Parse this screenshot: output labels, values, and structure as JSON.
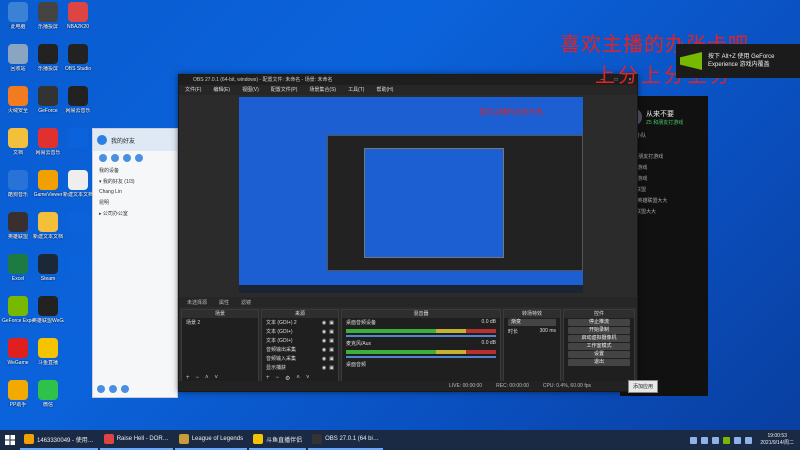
{
  "desktop": {
    "icons": [
      {
        "label": "此电脑",
        "color": "#3b82d6"
      },
      {
        "label": "乐播投屏",
        "color": "#444"
      },
      {
        "label": "NBA2K20",
        "color": "#d44"
      },
      {
        "label": "回收站",
        "color": "#8aa5c2"
      },
      {
        "label": "乐播投屏",
        "color": "#222"
      },
      {
        "label": "OBS Studio",
        "color": "#222"
      },
      {
        "label": "火绒安全",
        "color": "#f27b1f"
      },
      {
        "label": "GeForce",
        "color": "#333"
      },
      {
        "label": "网易云音乐",
        "color": "#222"
      },
      {
        "label": "文档",
        "color": "#f3c03c"
      },
      {
        "label": "网易云音乐",
        "color": "#e03030"
      },
      {
        "label": "",
        "color": "#0b63db"
      },
      {
        "label": "酷狗音乐",
        "color": "#2773d8"
      },
      {
        "label": "GameViewer",
        "color": "#f0a000"
      },
      {
        "label": "新建文本文档",
        "color": "#eee"
      },
      {
        "label": "英雄联盟",
        "color": "#3a2f2f"
      },
      {
        "label": "新建文本文档",
        "color": "#f3c03c"
      },
      {
        "label": "",
        "color": "#0b63db"
      },
      {
        "label": "Excel",
        "color": "#1d7a43"
      },
      {
        "label": "Steam",
        "color": "#1b2838"
      },
      {
        "label": "",
        "color": "#0b63db"
      },
      {
        "label": "GeForce Experience",
        "color": "#76b900"
      },
      {
        "label": "英雄联盟WeGame",
        "color": "#222"
      },
      {
        "label": "",
        "color": "#0b63db"
      },
      {
        "label": "WeGame",
        "color": "#e02020"
      },
      {
        "label": "斗鱼直播",
        "color": "#f5c400"
      },
      {
        "label": "",
        "color": "#0b63db"
      },
      {
        "label": "PP助手",
        "color": "#f2a900"
      },
      {
        "label": "微信",
        "color": "#2ec24a"
      },
      {
        "label": "",
        "color": "#0b63db"
      }
    ]
  },
  "overlay": {
    "line1": "喜欢主播的办张卡吧。",
    "line2": "上分上分上分"
  },
  "geforce_notice": {
    "text1": "按下 Alt+Z 使用 GeForce",
    "text2": "Experience 游戏内覆盖"
  },
  "chat_panel": {
    "name": "从来不要",
    "status": "Z5 和朋友打游戏",
    "lines": [
      "游戏小队",
      "(1/5)",
      "Z5 和朋友打游戏",
      "—— 游戏",
      "—— 游戏",
      "英雄联盟",
      "—— 英雄联盟大大",
      "英雄联盟大大"
    ]
  },
  "qq": {
    "title": "我的好友",
    "items": [
      "我的设备",
      "▾ 我的好友 (1/3)",
      "Chang Lin",
      "昆明",
      "▸ 公司办公室"
    ]
  },
  "obs": {
    "title": "OBS 27.0.1 (64-bit, windows) - 配置文件: 未命名 - 场景: 未命名",
    "menu": [
      "文件(F)",
      "编辑(E)",
      "视图(V)",
      "配置文件(P)",
      "场景集合(S)",
      "工具(T)",
      "帮助(H)"
    ],
    "context_bar": {
      "label": "未选择源",
      "properties": "属性",
      "filters": "滤镜"
    },
    "scenes": {
      "title": "场景",
      "items": [
        "场景 2"
      ]
    },
    "sources": {
      "title": "来源",
      "items": [
        "文本 (GDI+) 2",
        "文本 (GDI+)",
        "文本 (GDI+)",
        "音频输出采集",
        "音频输入采集",
        "显示捕获"
      ]
    },
    "mixer": {
      "title": "混音器",
      "channels": [
        {
          "name": "桌面音频设备",
          "db": "0.0 dB"
        },
        {
          "name": "麦克风/Aux",
          "db": "0.0 dB"
        }
      ],
      "extra": "桌面音频"
    },
    "transitions": {
      "title": "转场特效",
      "value": "渐变",
      "duration_label": "时长",
      "duration": "300 ms"
    },
    "controls": {
      "title": "控件",
      "buttons": [
        "停止推流",
        "开始录制",
        "启动虚拟摄像机",
        "工作室模式",
        "设置",
        "退出"
      ]
    },
    "status": {
      "live": "LIVE: 00:00:00",
      "rec": "REC: 00:00:00",
      "cpu": "CPU: 0.4%, 60.00 fps",
      "dropped": "00:00:00"
    }
  },
  "tooltip": "添加应用",
  "taskbar": {
    "items": [
      {
        "label": "1463330049 - 使用…",
        "color": "#f0a000"
      },
      {
        "label": "Raise Hell - DOR…",
        "color": "#d44"
      },
      {
        "label": "League of Legends",
        "color": "#c89b3c"
      },
      {
        "label": "斗鱼直播伴侣",
        "color": "#f5c400"
      },
      {
        "label": "OBS 27.0.1 (64 bi…",
        "color": "#333"
      }
    ],
    "clock_time": "19:00:53",
    "clock_date": "2021/9/14/周二"
  }
}
